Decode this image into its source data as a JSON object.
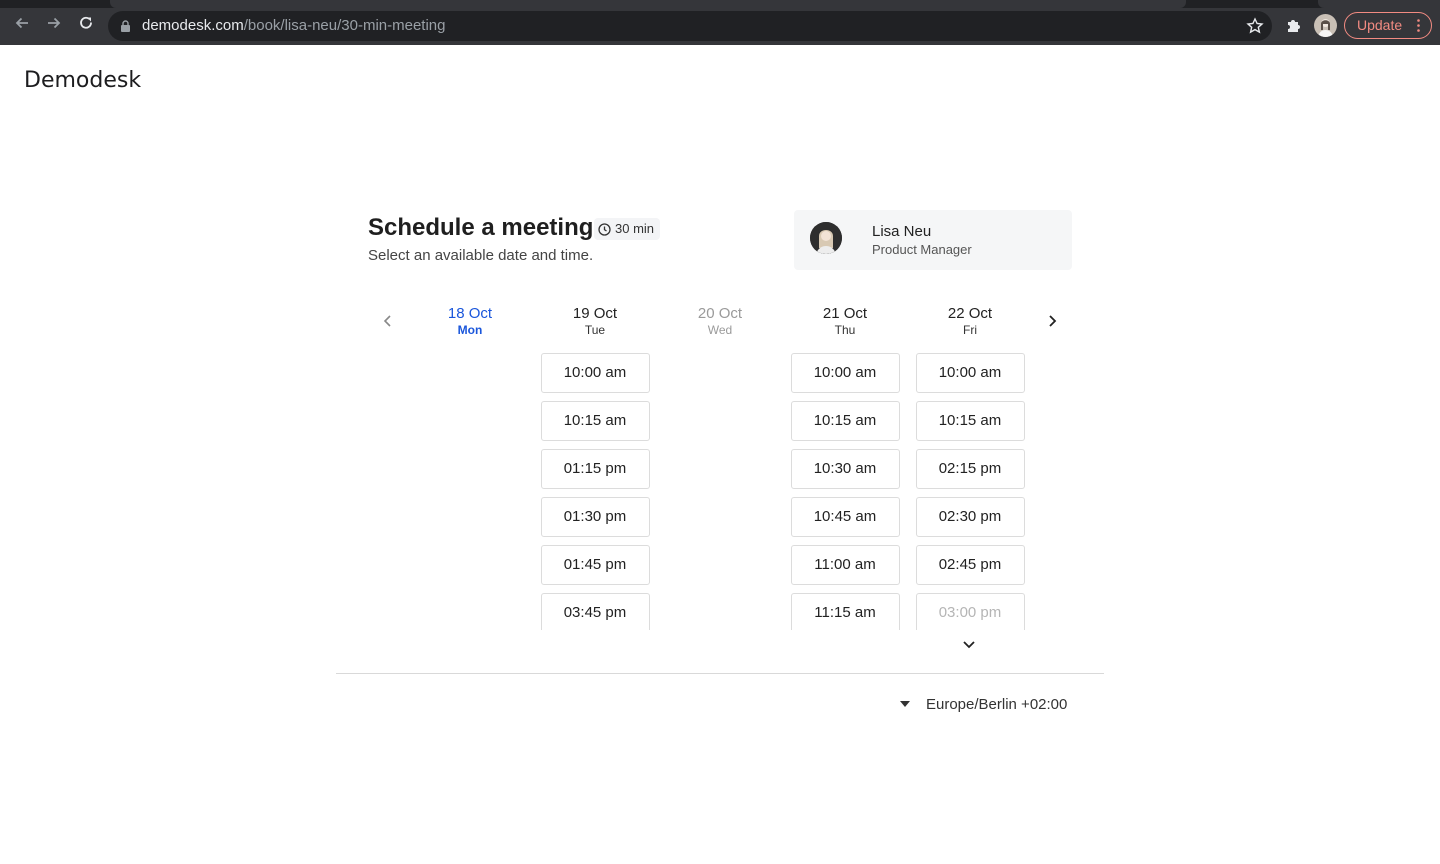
{
  "browser": {
    "url_host": "demodesk.com",
    "url_path": "/book/lisa-neu/30-min-meeting",
    "update_label": "Update"
  },
  "brand": {
    "logo_text": "Demodesk"
  },
  "header": {
    "title": "Schedule a meeting",
    "duration": "30 min",
    "subtitle": "Select an available date and time."
  },
  "host": {
    "name": "Lisa Neu",
    "role": "Product Manager"
  },
  "calendar": {
    "days": [
      {
        "date": "18 Oct",
        "dow": "Mon",
        "state": "selected",
        "slots": []
      },
      {
        "date": "19 Oct",
        "dow": "Tue",
        "state": "available",
        "slots": [
          "10:00 am",
          "10:15 am",
          "01:15 pm",
          "01:30 pm",
          "01:45 pm",
          "03:45 pm"
        ]
      },
      {
        "date": "20 Oct",
        "dow": "Wed",
        "state": "disabled",
        "slots": []
      },
      {
        "date": "21 Oct",
        "dow": "Thu",
        "state": "available",
        "slots": [
          "10:00 am",
          "10:15 am",
          "10:30 am",
          "10:45 am",
          "11:00 am",
          "11:15 am"
        ]
      },
      {
        "date": "22 Oct",
        "dow": "Fri",
        "state": "available",
        "slots": [
          "10:00 am",
          "10:15 am",
          "02:15 pm",
          "02:30 pm",
          "02:45 pm",
          "03:00 pm"
        ]
      }
    ]
  },
  "timezone": {
    "label": "Europe/Berlin +02:00"
  },
  "colors": {
    "accent": "#1a56db",
    "update": "#f28b82"
  }
}
